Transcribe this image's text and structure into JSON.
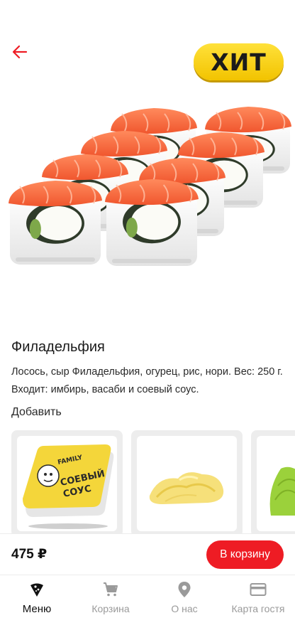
{
  "header": {
    "back_icon": "arrow-left-icon",
    "badge": "ХИТ",
    "accent_color": "#ee1c24",
    "badge_color": "#f7cf12"
  },
  "product": {
    "title": "Филадельфия",
    "description_line1": "Лосось, сыр Филадельфия, огурец, рис, нори. Вес: 250 г.",
    "description_line2": "Входит: имбирь, васаби и соевый соус.",
    "image": "philadelphia-roll-image"
  },
  "addons": {
    "heading": "Добавить",
    "items": [
      {
        "name": "soy-sauce",
        "lines": [
          "СОЕВЫЙ",
          "СОУС"
        ],
        "brand": "FAMILY"
      },
      {
        "name": "ginger"
      },
      {
        "name": "wasabi"
      }
    ]
  },
  "purchase": {
    "price": "475 ₽",
    "button": "В корзину"
  },
  "tabbar": {
    "items": [
      {
        "label": "Меню",
        "icon": "pizza-slice-icon",
        "active": true
      },
      {
        "label": "Корзина",
        "icon": "cart-icon",
        "active": false
      },
      {
        "label": "О нас",
        "icon": "location-pin-icon",
        "active": false
      },
      {
        "label": "Карта гостя",
        "icon": "credit-card-icon",
        "active": false
      }
    ]
  }
}
